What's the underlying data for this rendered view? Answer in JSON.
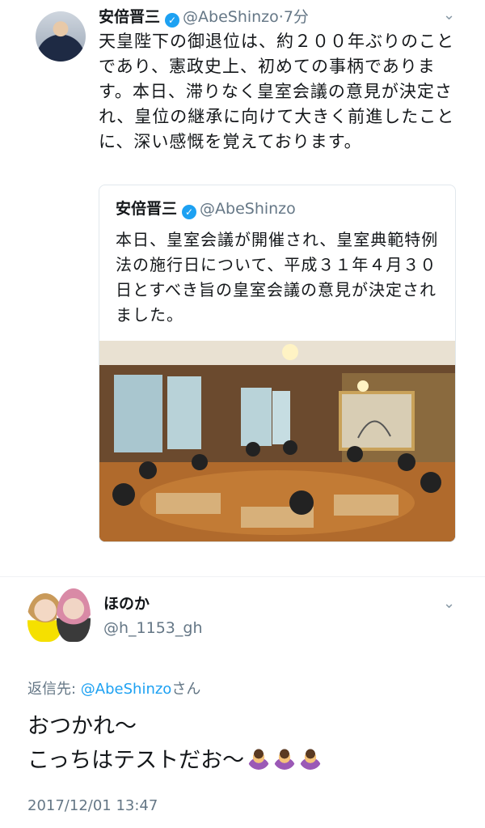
{
  "tweet": {
    "display_name": "安倍晋三",
    "handle": "@AbeShinzo",
    "time": "·7分",
    "text": "天皇陛下の御退位は、約２００年ぶりのことであり、憲政史上、初めての事柄であります。本日、滞りなく皇室会議の意見が決定され、皇位の継承に向けて大きく前進したことに、深い感慨を覚えております。"
  },
  "quoted": {
    "display_name": "安倍晋三",
    "handle": "@AbeShinzo",
    "text": "本日、皇室会議が開催され、皇室典範特例法の施行日について、平成３１年４月３０日とすべき旨の皇室会議の意見が決定されました。"
  },
  "reply": {
    "display_name": "ほのか",
    "handle": "@h_1153_gh",
    "reply_prefix": "返信先: ",
    "reply_mention": "@AbeShinzo",
    "reply_suffix": "さん",
    "line1": "おつかれ〜",
    "line2": "こっちはテストだお〜",
    "timestamp": "2017/12/01 13:47"
  },
  "icons": [
    "verified-badge-icon",
    "chevron-down-icon",
    "raising-hand-emoji"
  ],
  "colors": {
    "link": "#1da1f2",
    "secondary": "#657786",
    "text": "#14171a"
  }
}
